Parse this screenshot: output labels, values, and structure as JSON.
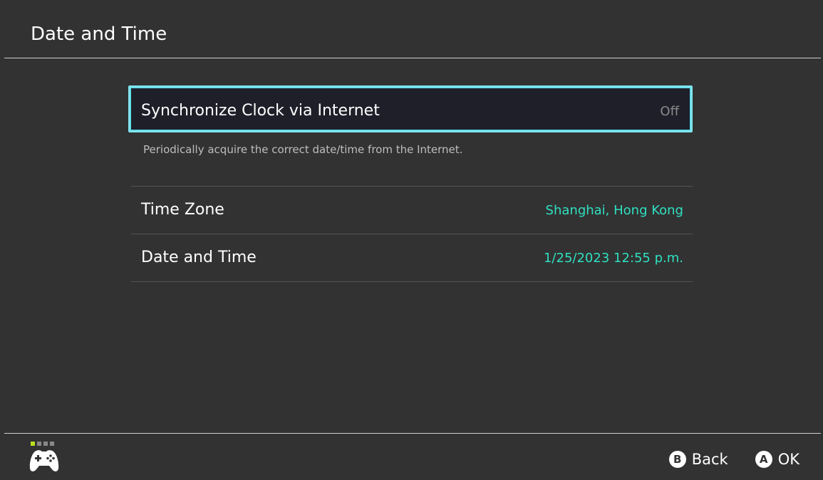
{
  "header": {
    "title": "Date and Time"
  },
  "sync_clock": {
    "label": "Synchronize Clock via Internet",
    "value": "Off",
    "description": "Periodically acquire the correct date/time from the Internet."
  },
  "settings": [
    {
      "label": "Time Zone",
      "value": "Shanghai, Hong Kong"
    },
    {
      "label": "Date and Time",
      "value": "1/25/2023 12:55 p.m."
    }
  ],
  "footer": {
    "back": {
      "glyph": "B",
      "label": "Back"
    },
    "ok": {
      "glyph": "A",
      "label": "OK"
    }
  },
  "player_indicator": {
    "active_players": 1,
    "total_slots": 4
  },
  "colors": {
    "background": "#323232",
    "focus_border": "#7fe3ec",
    "focus_fill": "#1f1f2a",
    "value_accent": "#2fe0c0",
    "player_active": "#b8e01f"
  },
  "icons": {
    "controller": "controller-icon",
    "button_b": "b-button-icon",
    "button_a": "a-button-icon"
  }
}
